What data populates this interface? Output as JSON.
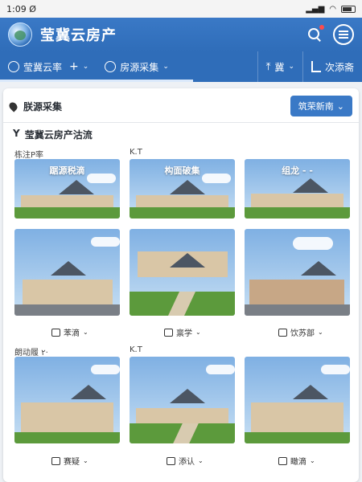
{
  "status": {
    "time": "1:09 Ø"
  },
  "app": {
    "title": "莹冀云房产"
  },
  "tabs": [
    {
      "label": "莹冀云率",
      "plus": "+",
      "chev": "⌄"
    },
    {
      "label": "房源采集",
      "chev": "⌄"
    }
  ],
  "tabs_right": [
    {
      "label": "冀",
      "chev": "⌄"
    },
    {
      "label": "次添斋"
    }
  ],
  "section": {
    "title": "朕源采集",
    "filter_label": "筑荣新南",
    "filter_chev": "⌄"
  },
  "subhead": {
    "prefix": "Y",
    "title": "莹冀云房产沽流"
  },
  "row1_labels": {
    "left": "栋注P率",
    "mid": "K.T"
  },
  "row1_captions": [
    "踞源税滴",
    "构面破集",
    "组龙 - -"
  ],
  "row3_actions": [
    {
      "label": "苯滴",
      "chev": "⌄"
    },
    {
      "label": "禀学",
      "chev": "⌄"
    },
    {
      "label": "饮苏部",
      "chev": "⌄"
    }
  ],
  "row4_labels": {
    "left": "朗动履 ٢·",
    "mid": "K.T"
  },
  "row5_actions": [
    {
      "label": "赛疑",
      "chev": "⌄"
    },
    {
      "label": "添认",
      "chev": "⌄"
    },
    {
      "label": "瞰滴",
      "chev": "⌄"
    }
  ]
}
